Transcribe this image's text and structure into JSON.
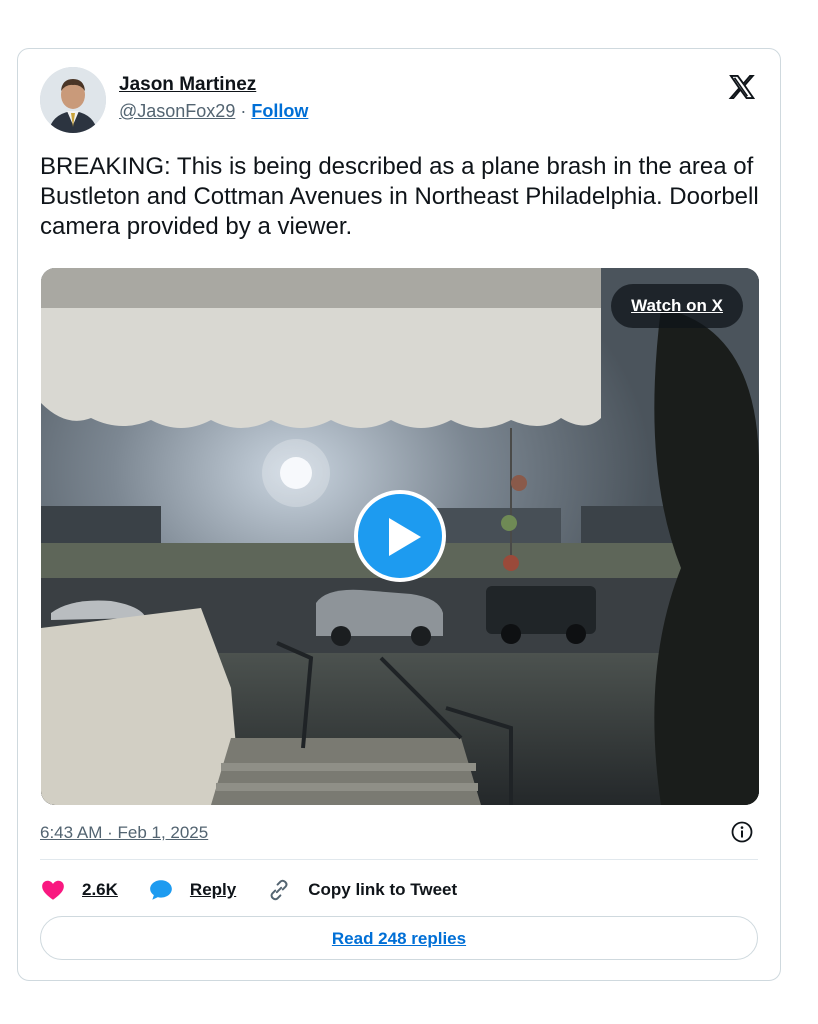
{
  "author": {
    "name": "Jason Martinez",
    "handle": "@JasonFox29",
    "separator": "·",
    "follow_label": "Follow"
  },
  "tweet": {
    "text": "BREAKING: This is being described as a plane brash in the area of Bustleton and Cottman Avenues in Northeast Philadelphia. Doorbell camera provided by a viewer.",
    "timestamp": "6:43 AM · Feb 1, 2025"
  },
  "media": {
    "watch_label": "Watch on X",
    "play_icon": "play-icon"
  },
  "actions": {
    "like_count": "2.6K",
    "reply_label": "Reply",
    "copy_label": "Copy link to Tweet"
  },
  "read_replies_label": "Read 248 replies",
  "icons": {
    "logo": "x-logo-icon",
    "info": "info-icon",
    "like": "heart-icon",
    "reply": "speech-bubble-icon",
    "copy": "link-icon"
  },
  "colors": {
    "accent": "#1d9bf0",
    "link": "#006fd6",
    "like": "#f91880",
    "muted": "#536471"
  }
}
